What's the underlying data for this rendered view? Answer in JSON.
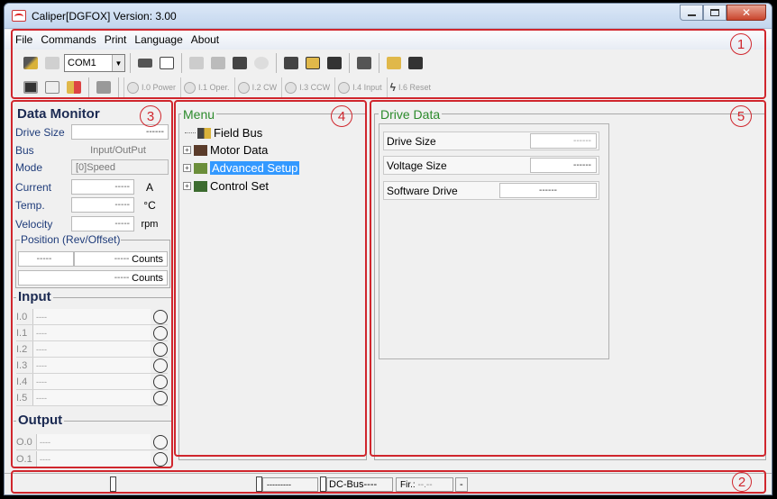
{
  "window": {
    "title": "Caliper[DGFOX] Version: 3.00"
  },
  "menu": [
    "File",
    "Commands",
    "Print",
    "Language",
    "About"
  ],
  "toolbar": {
    "port": "COM1",
    "row2_buttons": [
      {
        "label": "I.0 Power"
      },
      {
        "label": "I.1 Oper."
      },
      {
        "label": "I.2 CW"
      },
      {
        "label": "I.3 CCW"
      },
      {
        "label": "I.4 Input"
      },
      {
        "label": "I.6 Reset"
      }
    ]
  },
  "annotations": [
    "1",
    "2",
    "3",
    "4",
    "5"
  ],
  "data_monitor": {
    "title": "Data Monitor",
    "rows": [
      {
        "label": "Drive Size",
        "value": "------",
        "unit": ""
      },
      {
        "label": "Bus",
        "value": "Input/OutPut",
        "unit": ""
      },
      {
        "label": "Mode",
        "value": "[0]Speed",
        "unit": ""
      },
      {
        "label": "Current",
        "value": "-----",
        "unit": "A"
      },
      {
        "label": "Temp.",
        "value": "-----",
        "unit": "°C"
      },
      {
        "label": "Velocity",
        "value": "-----",
        "unit": "rpm"
      }
    ],
    "position_title": "Position (Rev/Offset)",
    "position_rows": [
      {
        "rev": "-----",
        "offset": "-----",
        "unit": "Counts"
      },
      {
        "rev": "",
        "offset": "-----",
        "unit": "Counts"
      }
    ]
  },
  "input": {
    "title": "Input",
    "rows": [
      {
        "label": "I.0",
        "value": "----"
      },
      {
        "label": "I.1",
        "value": "----"
      },
      {
        "label": "I.2",
        "value": "----"
      },
      {
        "label": "I.3",
        "value": "----"
      },
      {
        "label": "I.4",
        "value": "----"
      },
      {
        "label": "I.5",
        "value": "----"
      }
    ]
  },
  "output": {
    "title": "Output",
    "rows": [
      {
        "label": "O.0",
        "value": "----"
      },
      {
        "label": "O.1",
        "value": "----"
      }
    ]
  },
  "menu_tree": {
    "title": "Menu",
    "items": [
      {
        "label": "Field Bus",
        "expandable": false,
        "selected": false
      },
      {
        "label": "Motor Data",
        "expandable": true,
        "selected": false
      },
      {
        "label": "Advanced Setup",
        "expandable": true,
        "selected": true
      },
      {
        "label": "Control Set",
        "expandable": true,
        "selected": false
      }
    ]
  },
  "drive_data": {
    "title": "Drive Data",
    "rows": [
      {
        "label": "Drive Size",
        "value": "------"
      },
      {
        "label": "Voltage Size",
        "value": "------"
      },
      {
        "label": "Software Drive",
        "value": "------"
      }
    ]
  },
  "status": {
    "c1": "---------",
    "c2": "DC-Bus----",
    "c3_label": "Fir.:",
    "c3_value": "--.--",
    "c4": "-"
  }
}
